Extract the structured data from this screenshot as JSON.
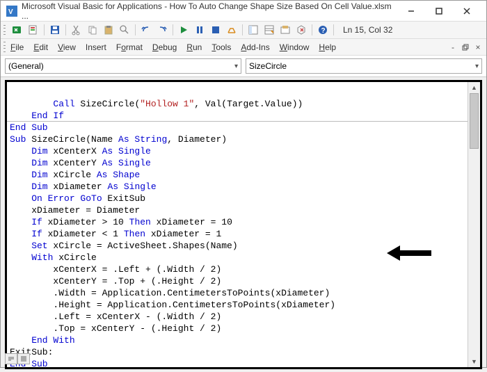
{
  "window": {
    "title": "Microsoft Visual Basic for Applications - How To Auto Change Shape Size Based On Cell Value.xlsm ..."
  },
  "toolbars": {
    "position_label": "Ln 15, Col 32"
  },
  "menu": {
    "file": "File",
    "edit": "Edit",
    "view": "View",
    "insert": "Insert",
    "format": "Format",
    "debug": "Debug",
    "run": "Run",
    "tools": "Tools",
    "addins": "Add-Ins",
    "window": "Window",
    "help": "Help"
  },
  "dropdowns": {
    "object": "(General)",
    "procedure": "SizeCircle"
  },
  "code": {
    "l1_a": "        Call",
    "l1_b": " SizeCircle(",
    "l1_c": "\"Hollow 1\"",
    "l1_d": ", Val(Target.Value))",
    "l2": "    End If",
    "l3": "End Sub",
    "l4_a": "Sub",
    "l4_b": " SizeCircle(Name ",
    "l4_c": "As String",
    "l4_d": ", Diameter)",
    "l5_a": "    Dim",
    "l5_b": " xCenterX ",
    "l5_c": "As Single",
    "l6_a": "    Dim",
    "l6_b": " xCenterY ",
    "l6_c": "As Single",
    "l7_a": "    Dim",
    "l7_b": " xCircle ",
    "l7_c": "As Shape",
    "l8_a": "    Dim",
    "l8_b": " xDiameter ",
    "l8_c": "As Single",
    "l9_a": "    On Error GoTo",
    "l9_b": " ExitSub",
    "l10": "    xDiameter = Diameter",
    "l11_a": "    If",
    "l11_b": " xDiameter > 10 ",
    "l11_c": "Then",
    "l11_d": " xDiameter = 10",
    "l12_a": "    If",
    "l12_b": " xDiameter < 1 ",
    "l12_c": "Then",
    "l12_d": " xDiameter = 1",
    "l13_a": "    Set",
    "l13_b": " xCircle = ActiveSheet.Shapes(Name)",
    "l14_a": "    With",
    "l14_b": " xCircle",
    "l15": "        xCenterX = .Left + (.Width / 2)",
    "l16": "        xCenterY = .Top + (.Height / 2)",
    "l17": "        .Width = Application.CentimetersToPoints(xDiameter)",
    "l18": "        .Height = Application.CentimetersToPoints(xDiameter)",
    "l19": "        .Left = xCenterX - (.Width / 2)",
    "l20": "        .Top = xCenterY - (.Height / 2)",
    "l21": "    End With",
    "l22": "ExitSub:",
    "l23": "End Sub"
  }
}
